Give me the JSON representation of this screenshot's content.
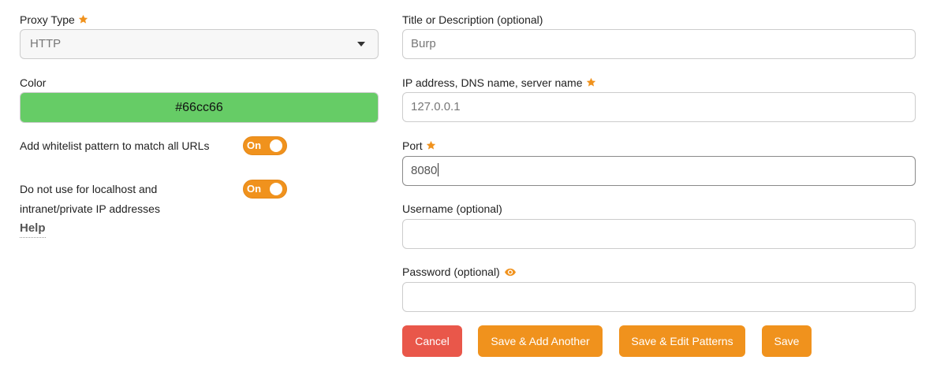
{
  "left": {
    "proxy_type": {
      "label": "Proxy Type",
      "value": "HTTP"
    },
    "color": {
      "label": "Color",
      "value": "#66cc66"
    },
    "whitelist": {
      "label": "Add whitelist pattern to match all URLs",
      "toggle": "On"
    },
    "localhost": {
      "label_line1": "Do not use for localhost and",
      "label_line2": "intranet/private IP addresses",
      "toggle": "On"
    },
    "help": "Help"
  },
  "right": {
    "title": {
      "label": "Title or Description (optional)",
      "value": "Burp"
    },
    "address": {
      "label": "IP address, DNS name, server name",
      "value": "127.0.0.1"
    },
    "port": {
      "label": "Port",
      "value": "8080"
    },
    "username": {
      "label": "Username (optional)",
      "value": ""
    },
    "password": {
      "label": "Password (optional)",
      "value": ""
    }
  },
  "buttons": {
    "cancel": "Cancel",
    "save_add": "Save & Add Another",
    "save_edit": "Save & Edit Patterns",
    "save": "Save"
  },
  "colors": {
    "accent": "#f0921d",
    "danger": "#e9574a",
    "color_swatch": "#66cc66"
  },
  "icons": {
    "required": "star-icon",
    "show_password": "eye-icon",
    "dropdown": "chevron-down-icon"
  }
}
